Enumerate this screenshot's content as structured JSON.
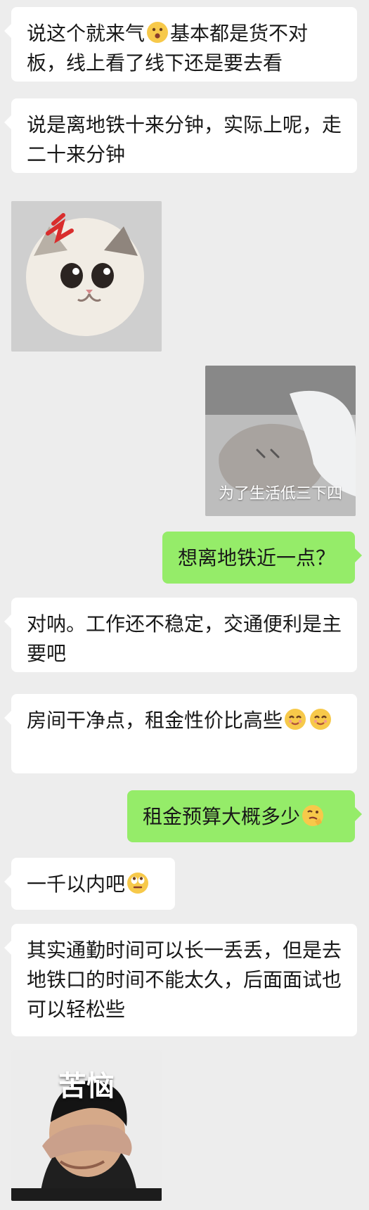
{
  "chat": {
    "messages": [
      {
        "side": "left",
        "type": "text",
        "parts": [
          "说这个就来气",
          {
            "emoji": "surprised-face-icon"
          },
          "基本都是货不对板，线上看了线下还是要去看"
        ]
      },
      {
        "side": "left",
        "type": "text",
        "parts": [
          "说是离地铁十来分钟，实际上呢，走二十来分钟"
        ]
      },
      {
        "side": "left",
        "type": "image",
        "image_name": "angry-kitten-sticker",
        "label": ""
      },
      {
        "side": "right",
        "type": "image",
        "image_name": "cat-under-towel-sticker",
        "label": "为了生活低三下四"
      },
      {
        "side": "right",
        "type": "text",
        "parts": [
          "想离地铁近一点？"
        ]
      },
      {
        "side": "left",
        "type": "text",
        "parts": [
          "对呐。工作还不稳定，交通便利是主要吧"
        ]
      },
      {
        "side": "left",
        "type": "text",
        "parts": [
          "房间干净点，租金性价比高些",
          {
            "emoji": "smiling-eyes-icon"
          },
          {
            "emoji": "smiling-eyes-icon"
          }
        ]
      },
      {
        "side": "right",
        "type": "text",
        "parts": [
          "租金预算大概多少",
          {
            "emoji": "thinking-face-icon"
          }
        ]
      },
      {
        "side": "left",
        "type": "text",
        "parts": [
          "一千以内吧",
          {
            "emoji": "rolling-eyes-icon"
          }
        ]
      },
      {
        "side": "left",
        "type": "text",
        "parts": [
          "其实通勤时间可以长一丢丢，但是去地铁口的时间不能太久，后面面试也可以轻松些"
        ]
      },
      {
        "side": "left",
        "type": "image",
        "image_name": "troubled-boy-sticker",
        "label": "苦恼"
      }
    ]
  },
  "colors": {
    "background": "#ededed",
    "left_bubble": "#ffffff",
    "right_bubble": "#95ec69",
    "text": "#191919"
  }
}
